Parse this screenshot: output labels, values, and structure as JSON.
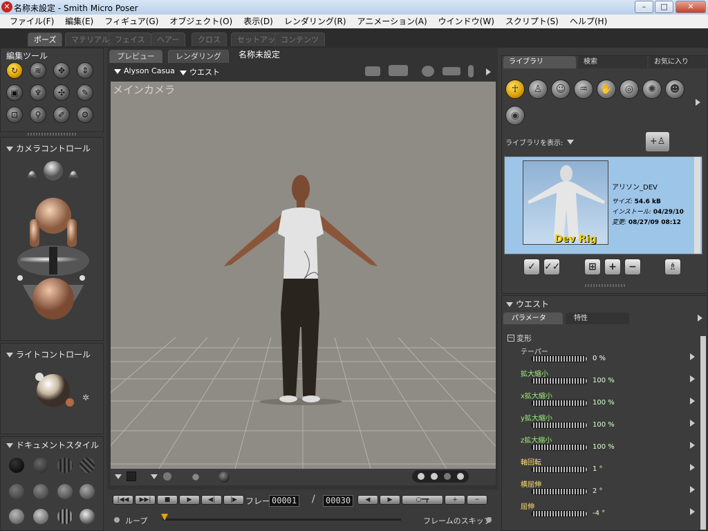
{
  "window": {
    "title": "名称未設定 - Smith Micro Poser",
    "min": "–",
    "max": "□",
    "close": "✕"
  },
  "menu": [
    "ファイル(F)",
    "編集(E)",
    "フィギュア(G)",
    "オブジェクト(O)",
    "表示(D)",
    "レンダリング(R)",
    "アニメーション(A)",
    "ウインドウ(W)",
    "スクリプト(S)",
    "ヘルプ(H)"
  ],
  "rooms": [
    "ポーズ",
    "マテリアル",
    "フェイス",
    "ヘアー",
    "クロス",
    "セットアップ",
    "コンテンツ"
  ],
  "left": {
    "edit_tools": "編集ツール",
    "camera_controls": "カメラコントロール",
    "light_controls": "ライトコントロール",
    "document_style": "ドキュメントスタイル"
  },
  "viewport": {
    "tabs": [
      "プレビュー",
      "レンダリング"
    ],
    "doc_title": "名称未設定",
    "figure_menu": "Alyson Casua",
    "part_menu": "ウエスト",
    "camera_label": "メインカメラ"
  },
  "transport": {
    "frame_label": "フレーム:",
    "current": "00001",
    "total": "00030",
    "loop": "ループ",
    "skip": "フレームのスキップ"
  },
  "library": {
    "tabs": [
      "ライブラリ",
      "検索",
      "お気に入り"
    ],
    "show_label": "ライブラリを表示:",
    "item": {
      "name": "アリソン_DEV",
      "size_label": "サイズ:",
      "size": "54.6 kB",
      "install_label": "インストール:",
      "install": "04/29/10",
      "modified_label": "変更:",
      "modified": "08/27/09 08:12",
      "thumb_caption": "Dev Rig"
    }
  },
  "params": {
    "title": "ウエスト",
    "tabs": [
      "パラメータ",
      "特性"
    ],
    "group": "変形",
    "rows": [
      {
        "name": "テーパー",
        "value": "0 %",
        "cls": "wh",
        "vcls": "w"
      },
      {
        "name": "拡大縮小",
        "value": "100 %",
        "cls": "g",
        "vcls": ""
      },
      {
        "name": "x拡大縮小",
        "value": "100 %",
        "cls": "g",
        "vcls": ""
      },
      {
        "name": "y拡大縮小",
        "value": "100 %",
        "cls": "g",
        "vcls": ""
      },
      {
        "name": "z拡大縮小",
        "value": "100 %",
        "cls": "g",
        "vcls": ""
      },
      {
        "name": "軸回転",
        "value": "1 °",
        "cls": "y",
        "vcls": ""
      },
      {
        "name": "横屈伸",
        "value": "2 °",
        "cls": "y",
        "vcls": ""
      },
      {
        "name": "屈伸",
        "value": "-4 °",
        "cls": "y",
        "vcls": ""
      }
    ]
  }
}
